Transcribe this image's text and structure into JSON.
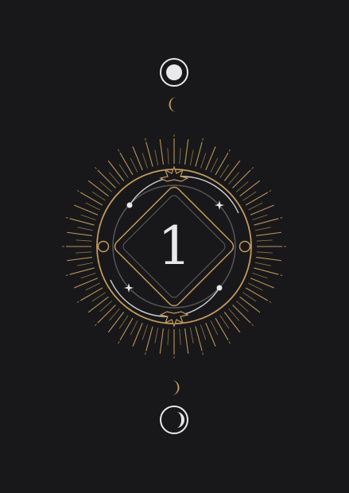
{
  "card": {
    "number": "1",
    "colors": {
      "background": "#18181a",
      "gold": "#c49a5c",
      "silver": "#e9e9ec",
      "grey_ring": "#55555a"
    },
    "icons": {
      "top_moon": "full-moon-icon",
      "top_crescent": "waxing-crescent-icon",
      "bottom_crescent": "waning-crescent-icon",
      "bottom_moon": "crescent-moon-icon",
      "emblem": "sun-burst-emblem",
      "sparkle": "sparkle-star-icon"
    }
  }
}
